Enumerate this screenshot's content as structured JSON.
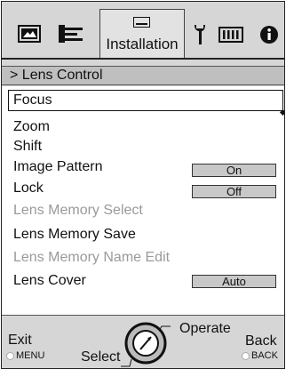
{
  "tabs": {
    "active_label": "Installation"
  },
  "breadcrumb": {
    "text": "> Lens Control"
  },
  "menu": {
    "items": [
      {
        "label": "Focus"
      },
      {
        "label": "Zoom"
      },
      {
        "label": "Shift"
      },
      {
        "label": "Image Pattern",
        "value": "On"
      },
      {
        "label": "Lock",
        "value": "Off"
      },
      {
        "label": "Lens Memory Select"
      },
      {
        "label": "Lens Memory Save"
      },
      {
        "label": "Lens Memory Name Edit"
      },
      {
        "label": "Lens Cover",
        "value": "Auto"
      }
    ]
  },
  "footer": {
    "exit_label": "Exit",
    "exit_key": "MENU",
    "select_label": "Select",
    "operate_label": "Operate",
    "back_label": "Back",
    "back_key": "BACK"
  }
}
